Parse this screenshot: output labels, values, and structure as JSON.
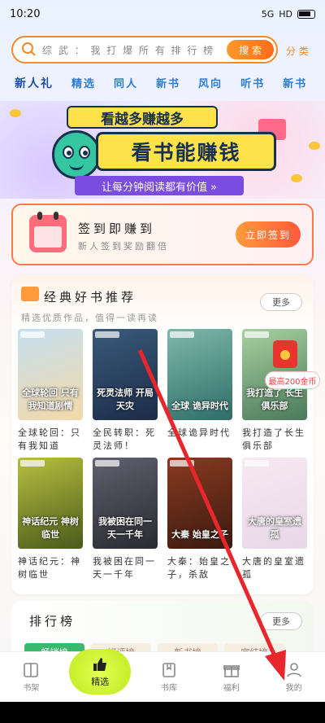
{
  "status": {
    "time": "10:20",
    "network": "5G",
    "hd": "HD"
  },
  "search": {
    "placeholder": "综 武 ： 我 打 爆 所 有 排 行 榜",
    "button": "搜 索",
    "category": "分 类"
  },
  "tabs": [
    "新人礼",
    "精选",
    "同人",
    "新书",
    "风向",
    "听书",
    "新书"
  ],
  "banner": {
    "headline": "看越多赚越多",
    "main": "看书能赚钱",
    "sub": "让每分钟阅读都有价值 »"
  },
  "checkin": {
    "title": "签到即赚到",
    "subtitle": "新人签到奖励翻倍",
    "button": "立即签到"
  },
  "recommend": {
    "title": "经典好书推荐",
    "subtitle": "精选优质作品，值得一读再读",
    "more": "更多",
    "reward_tag": "最高200金币",
    "books": [
      {
        "cover_text": "全球轮回 只有我知道剧情",
        "title": "全球轮回：只有我知道",
        "color1": "#f4d9a8",
        "color2": "#c5e0f0"
      },
      {
        "cover_text": "死灵法师 开局天灾",
        "title": "全民转职：死灵法师！",
        "color1": "#1c2c4a",
        "color2": "#3a5a7a"
      },
      {
        "cover_text": "全球 诡异时代",
        "title": "全球诡异时代",
        "color1": "#2f6d6a",
        "color2": "#7fb8a8"
      },
      {
        "cover_text": "我打造了 长生俱乐部",
        "title": "我打造了长生俱乐部",
        "color1": "#4a7a5a",
        "color2": "#a8d0a0"
      },
      {
        "cover_text": "神话纪元 神树临世",
        "title": "神话纪元：神树临世",
        "color1": "#4a5a1a",
        "color2": "#b8c040"
      },
      {
        "cover_text": "我被困在同一天一千年",
        "title": "我被困在同一天一千年",
        "color1": "#2a2a30",
        "color2": "#606070"
      },
      {
        "cover_text": "大秦 始皇之子",
        "title": "大秦：始皇之子，杀敌",
        "color1": "#3a1a10",
        "color2": "#8a3a20"
      },
      {
        "cover_text": "大唐的皇室遗孤",
        "title": "大唐的皇室遗孤",
        "color1": "#e8d8e8",
        "color2": "#f8e8f0"
      }
    ]
  },
  "ranking": {
    "title": "排行榜",
    "more": "更多",
    "tabs": [
      "畅销榜",
      "好评榜",
      "新书榜",
      "完结榜"
    ]
  },
  "nav": [
    {
      "label": "书架",
      "icon": "bookshelf-icon"
    },
    {
      "label": "精选",
      "icon": "thumb-up-icon"
    },
    {
      "label": "书库",
      "icon": "library-icon"
    },
    {
      "label": "福利",
      "icon": "gift-icon"
    },
    {
      "label": "我的",
      "icon": "profile-icon"
    }
  ],
  "colors": {
    "accent": "#f08a2b",
    "tab_blue": "#2a7dd6",
    "annotation_arrow": "#e8262b"
  }
}
